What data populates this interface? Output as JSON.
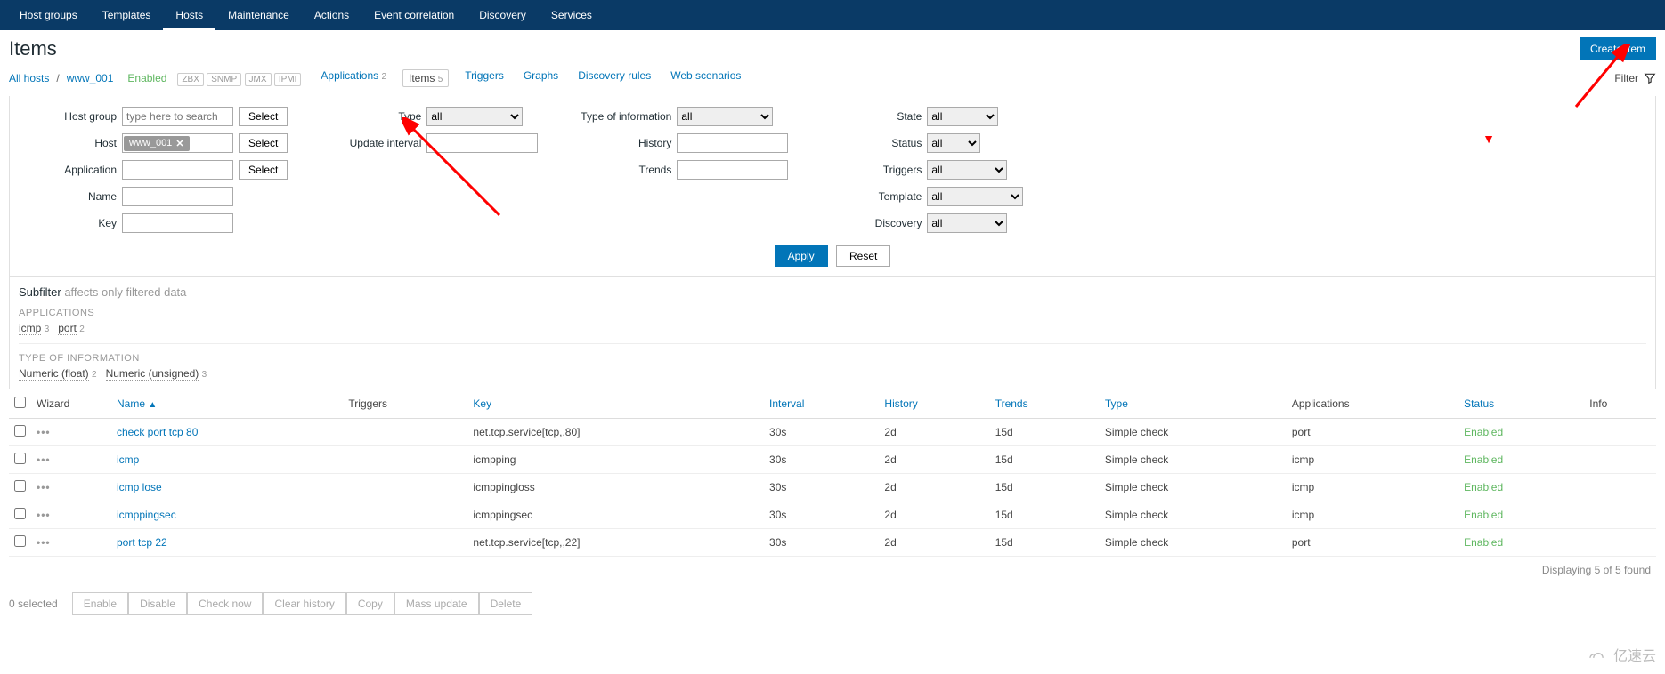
{
  "topnav": [
    "Host groups",
    "Templates",
    "Hosts",
    "Maintenance",
    "Actions",
    "Event correlation",
    "Discovery",
    "Services"
  ],
  "topnav_active": "Hosts",
  "page_title": "Items",
  "create_button": "Create item",
  "breadcrumb": {
    "all_hosts": "All hosts",
    "host": "www_001",
    "status": "Enabled",
    "indicators": [
      "ZBX",
      "SNMP",
      "JMX",
      "IPMI"
    ]
  },
  "host_tabs": [
    {
      "label": "Applications",
      "count": "2"
    },
    {
      "label": "Items",
      "count": "5",
      "active": true
    },
    {
      "label": "Triggers",
      "count": ""
    },
    {
      "label": "Graphs",
      "count": ""
    },
    {
      "label": "Discovery rules",
      "count": ""
    },
    {
      "label": "Web scenarios",
      "count": ""
    }
  ],
  "filter_label": "Filter",
  "filter": {
    "labels": {
      "host_group": "Host group",
      "host": "Host",
      "application": "Application",
      "name": "Name",
      "key": "Key",
      "type": "Type",
      "update_interval": "Update interval",
      "type_info": "Type of information",
      "history": "History",
      "trends": "Trends",
      "state": "State",
      "status": "Status",
      "triggers": "Triggers",
      "template": "Template",
      "discovery": "Discovery"
    },
    "host_group_placeholder": "type here to search",
    "host_token": "www_001",
    "select_btn": "Select",
    "type_value": "all",
    "state_value": "all",
    "status_value": "all",
    "triggers_value": "all",
    "template_value": "all",
    "discovery_value": "all",
    "apply": "Apply",
    "reset": "Reset"
  },
  "subfilter": {
    "title": "Subfilter",
    "title_suffix": "affects only filtered data",
    "apps_heading": "APPLICATIONS",
    "apps": [
      {
        "name": "icmp",
        "count": "3"
      },
      {
        "name": "port",
        "count": "2"
      }
    ],
    "type_heading": "TYPE OF INFORMATION",
    "types": [
      {
        "name": "Numeric (float)",
        "count": "2"
      },
      {
        "name": "Numeric (unsigned)",
        "count": "3"
      }
    ]
  },
  "columns": {
    "wizard": "Wizard",
    "name": "Name",
    "triggers": "Triggers",
    "key": "Key",
    "interval": "Interval",
    "history": "History",
    "trends": "Trends",
    "type": "Type",
    "applications": "Applications",
    "status": "Status",
    "info": "Info"
  },
  "rows": [
    {
      "name": "check port tcp 80",
      "key": "net.tcp.service[tcp,,80]",
      "interval": "30s",
      "history": "2d",
      "trends": "15d",
      "type": "Simple check",
      "app": "port",
      "status": "Enabled"
    },
    {
      "name": "icmp",
      "key": "icmpping",
      "interval": "30s",
      "history": "2d",
      "trends": "15d",
      "type": "Simple check",
      "app": "icmp",
      "status": "Enabled"
    },
    {
      "name": "icmp lose",
      "key": "icmppingloss",
      "interval": "30s",
      "history": "2d",
      "trends": "15d",
      "type": "Simple check",
      "app": "icmp",
      "status": "Enabled"
    },
    {
      "name": "icmppingsec",
      "key": "icmppingsec",
      "interval": "30s",
      "history": "2d",
      "trends": "15d",
      "type": "Simple check",
      "app": "icmp",
      "status": "Enabled"
    },
    {
      "name": "port tcp 22",
      "key": "net.tcp.service[tcp,,22]",
      "interval": "30s",
      "history": "2d",
      "trends": "15d",
      "type": "Simple check",
      "app": "port",
      "status": "Enabled"
    }
  ],
  "display_count": "Displaying 5 of 5 found",
  "footer": {
    "selected": "0 selected",
    "buttons": [
      "Enable",
      "Disable",
      "Check now",
      "Clear history",
      "Copy",
      "Mass update",
      "Delete"
    ]
  },
  "watermark": "亿速云"
}
